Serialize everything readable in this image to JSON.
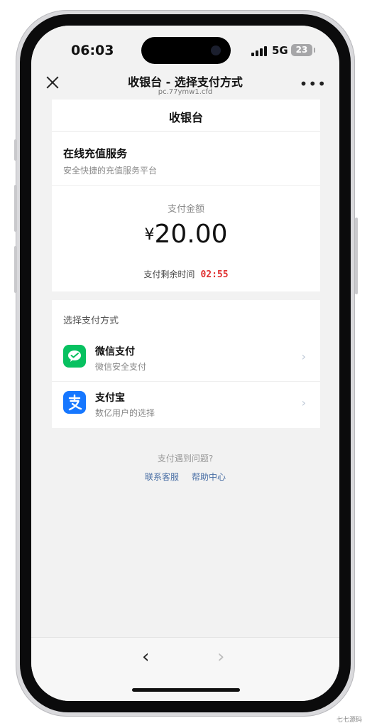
{
  "status": {
    "time": "06:03",
    "network": "5G",
    "battery": "23"
  },
  "nav": {
    "title": "收银台 - 选择支付方式",
    "url": "pc.77ymw1.cfd",
    "more": "•••"
  },
  "header": {
    "title": "收银台"
  },
  "service": {
    "title": "在线充值服务",
    "subtitle": "安全快捷的充值服务平台"
  },
  "amount": {
    "label": "支付金额",
    "currency": "¥",
    "value": "20.00",
    "timer_label": "支付剩余时间",
    "timer_value": "02:55"
  },
  "payment": {
    "heading": "选择支付方式",
    "methods": [
      {
        "name": "微信支付",
        "desc": "微信安全支付",
        "icon": "wechat-pay-icon",
        "color": "#07c160"
      },
      {
        "name": "支付宝",
        "desc": "数亿用户的选择",
        "icon": "alipay-icon",
        "color": "#1677ff"
      }
    ]
  },
  "help": {
    "question": "支付遇到问题?",
    "links": [
      "联系客服",
      "帮助中心"
    ]
  },
  "toolbar": {
    "back": "‹",
    "forward": "›"
  },
  "watermark": "七七源码"
}
